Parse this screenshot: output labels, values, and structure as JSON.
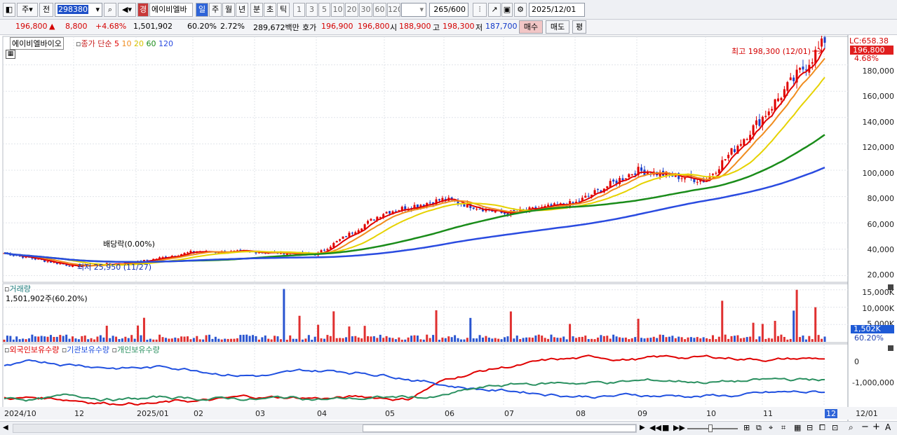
{
  "toolbar": {
    "period_type": "주",
    "prev_label": "전",
    "code": "298380",
    "mode_badge": "경",
    "stock_name": "에이비엘바",
    "periods": [
      "일",
      "주",
      "월",
      "년",
      "분",
      "초",
      "틱"
    ],
    "active_period": "일",
    "intervals": [
      "1",
      "3",
      "5",
      "10",
      "20",
      "30",
      "60",
      "120"
    ],
    "interval_value": "",
    "count_display": "265",
    "count_max": "/600",
    "date": "2025/12/01"
  },
  "quote": {
    "price": "196,800",
    "change_arrow": "▲",
    "change": "8,800",
    "change_pct": "+4.68%",
    "volume": "1,501,902",
    "vol_ratio": "60.20%",
    "turnover": "2.72%",
    "amount": "289,672백만",
    "hoga_label": "호가",
    "ask": "196,900",
    "bid": "196,800",
    "open_label": "시",
    "open": "188,900",
    "high_label": "고",
    "high": "198,300",
    "low_label": "저",
    "low": "187,700",
    "buy_label": "매수",
    "sell_label": "매도",
    "eval_label": "평"
  },
  "price_panel": {
    "name": "에이비엘바이오",
    "ma_label": "종가 단순",
    "ma_periods": [
      "5",
      "10",
      "20",
      "60",
      "120"
    ],
    "ma_colors": [
      "#e00000",
      "#f08c1e",
      "#e6d200",
      "#1a8c1a",
      "#2a4be0"
    ],
    "high_annotation": "최고 198,300 (12/01)",
    "low_annotation": "최저 25,950 (11/27)",
    "dividend_annotation": "배당락(0.00%)",
    "lc_label": "LC:658.38",
    "price_tag": "196,800",
    "price_tag_pct": "4.68%",
    "y_ticks": [
      "180,000",
      "160,000",
      "140,000",
      "120,000",
      "100,000",
      "80,000",
      "60,000",
      "40,000",
      "20,000"
    ]
  },
  "volume_panel": {
    "title": "거래량",
    "value_label": "1,501,902주(60.20%)",
    "y_ticks": [
      "15,000K",
      "10,000K",
      "5,000K"
    ],
    "tag": "1,502K",
    "tag_pct": "60.20%"
  },
  "holdings_panel": {
    "series": [
      "외국인보유수량",
      "기관보유수량",
      "개인보유수량"
    ],
    "colors": [
      "#e00000",
      "#2050e0",
      "#2a9060"
    ],
    "y_ticks": [
      "0",
      "-1,000,000"
    ]
  },
  "x_axis": [
    "2024/10",
    "12",
    "2025/01",
    "02",
    "03",
    "04",
    "05",
    "06",
    "07",
    "08",
    "09",
    "10",
    "11",
    "12",
    "12/01"
  ],
  "chart_data": {
    "type": "candlestick",
    "title": "에이비엘바이오",
    "period": "daily",
    "x": [
      "2024/10",
      "12",
      "2025/01",
      "02",
      "03",
      "04",
      "05",
      "06",
      "07",
      "08",
      "09",
      "10",
      "11",
      "12"
    ],
    "close_approx": [
      37000,
      27000,
      30000,
      38000,
      38000,
      36000,
      68000,
      78000,
      67000,
      75000,
      100000,
      92000,
      140000,
      196800
    ],
    "high": 198300,
    "low": 25950,
    "volume_max_k": 15000,
    "ylim": [
      20000,
      200000
    ]
  }
}
